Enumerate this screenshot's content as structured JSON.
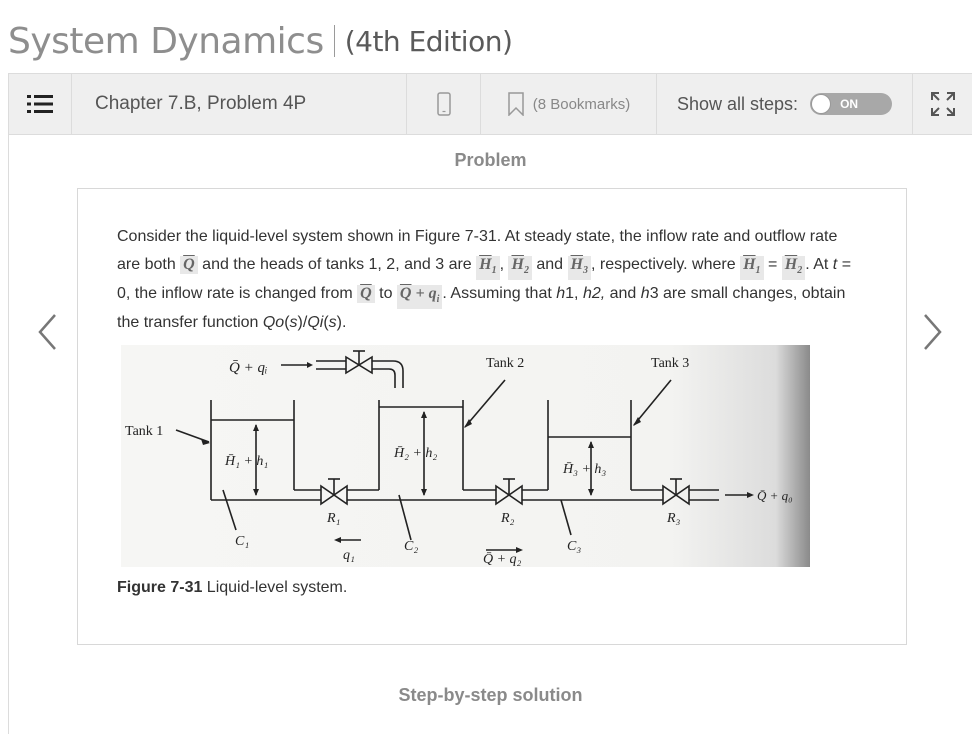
{
  "header": {
    "book_title": "System Dynamics",
    "edition": "(4th Edition)"
  },
  "toolbar": {
    "menu_icon": "list-icon",
    "chapter_label": "Chapter 7.B, Problem 4P",
    "device_icon": "mobile-phone-icon",
    "bookmark_icon": "bookmark-icon",
    "bookmarks_label": "(8 Bookmarks)",
    "show_steps_label": "Show all steps:",
    "toggle_state": "ON",
    "expand_icon": "expand-icon"
  },
  "problem": {
    "section_title": "Problem",
    "text": {
      "p1": "Consider the liquid-level system shown in Figure 7-31. At steady state, the inflow rate and outflow rate are both ",
      "q_bar": "Q",
      "p2": " and the heads of tanks 1, 2, and 3 are ",
      "H1": "H",
      "H1_sub": "1",
      "comma1": ", ",
      "H2": "H",
      "H2_sub": "2",
      "p3": " and ",
      "H3": "H",
      "H3_sub": "3",
      "p4": ", respectively. where ",
      "eq": " = ",
      "p5": ". At ",
      "t": "t",
      "p6": " = 0, the inflow rate is changed from ",
      "p7": " to ",
      "q_plus": " + q",
      "q_sub": "i",
      "p8": ". Assuming that ",
      "h1": "h",
      "h1n": "1, ",
      "h2": "h",
      "h2n": "2,",
      "p9": " and ",
      "h3": "h",
      "h3n": "3 are small changes, obtain the transfer function ",
      "Qo": "Qo",
      "s1": "s",
      "slash": ")/",
      "Qi": "Qi",
      "s2": "s",
      "end": ")."
    },
    "figure": {
      "labels": {
        "inflow": "Q̄ + qᵢ",
        "tank1": "Tank 1",
        "tank2": "Tank 2",
        "tank3": "Tank 3",
        "h1": "H̄₁ + h₁",
        "h2": "H̄₂ + h₂",
        "h3": "H̄₃ + h₃",
        "r1": "R₁",
        "r2": "R₂",
        "r3": "R₃",
        "c1": "C₁",
        "c2": "C₂",
        "c3": "C₃",
        "q1": "q₁",
        "q2": "Q̄ + q₂",
        "outflow": "Q̄ + q₀"
      },
      "caption_bold": "Figure 7-31",
      "caption_text": " Liquid-level system."
    }
  },
  "solution": {
    "section_title": "Step-by-step solution"
  },
  "navigation": {
    "prev_icon": "chevron-left-icon",
    "next_icon": "chevron-right-icon"
  }
}
